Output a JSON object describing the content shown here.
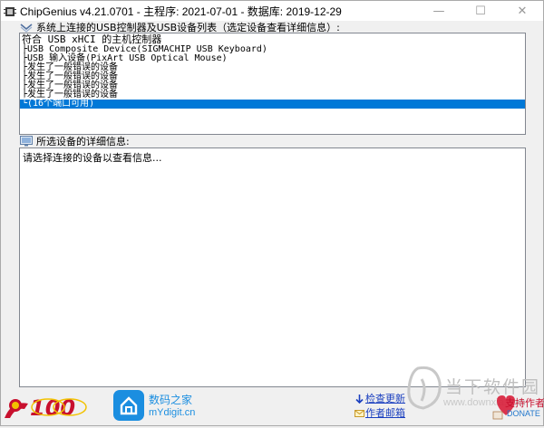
{
  "window": {
    "title": "ChipGenius v4.21.0701 - 主程序: 2021-07-01 - 数据库: 2019-12-29",
    "minimize_glyph": "—",
    "maximize_glyph": "☐",
    "close_glyph": "✕"
  },
  "device_section": {
    "label": "系统上连接的USB控制器及USB设备列表（选定设备查看详细信息）:",
    "icon": "usb-tree-icon",
    "items": [
      {
        "text": "符合 USB xHCI 的主机控制器",
        "selected": false
      },
      {
        "text": "├USB Composite Device(SIGMACHIP USB Keyboard)",
        "selected": false
      },
      {
        "text": "├USB 输入设备(PixArt USB Optical Mouse)",
        "selected": false
      },
      {
        "text": "├发生了一般错误的设备",
        "selected": false
      },
      {
        "text": "├发生了一般错误的设备",
        "selected": false
      },
      {
        "text": "├发生了一般错误的设备",
        "selected": false
      },
      {
        "text": "├发生了一般错误的设备",
        "selected": false
      },
      {
        "text": "└(16个端口可用)",
        "selected": true
      }
    ]
  },
  "detail_section": {
    "label": "所选设备的详细信息:",
    "icon": "monitor-icon",
    "placeholder": "请选择连接的设备以查看信息..."
  },
  "footer": {
    "centenary_logo": "100",
    "home_logo_text": "数码之家",
    "home_logo_url_text": "mYdigit.cn",
    "check_update_label": "检查更新",
    "author_email_label": "作者邮箱",
    "watermark_text": "当下软件园",
    "watermark_sub": "www.downxia.com",
    "donate_label": "支持作者",
    "donate_sub": "DONATE"
  },
  "colors": {
    "selection": "#0078d7",
    "link": "#1a3fbf",
    "brand_blue": "#1b8ee0",
    "party_red": "#c8102e"
  }
}
